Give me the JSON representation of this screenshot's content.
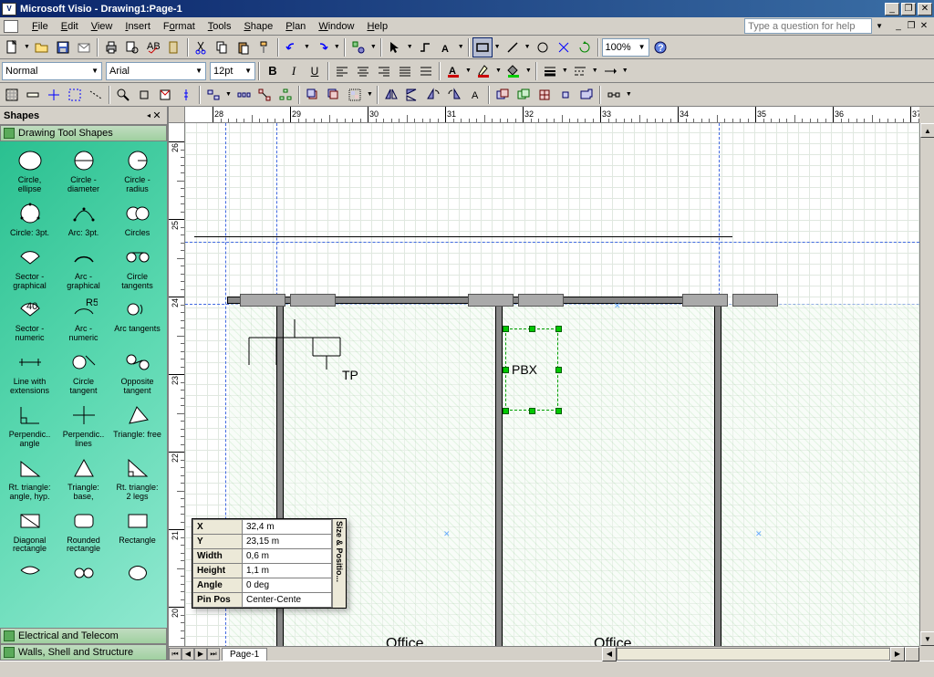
{
  "titlebar": {
    "app": "Microsoft Visio",
    "doc": "Drawing1:Page-1"
  },
  "menu": {
    "file": "File",
    "edit": "Edit",
    "view": "View",
    "insert": "Insert",
    "format": "Format",
    "tools": "Tools",
    "shape": "Shape",
    "plan": "Plan",
    "window": "Window",
    "help": "Help",
    "help_placeholder": "Type a question for help"
  },
  "toolbar2": {
    "style": "Normal",
    "font": "Arial",
    "size": "12pt",
    "zoom": "100%"
  },
  "shapes": {
    "title": "Shapes",
    "stencils": [
      "Drawing Tool Shapes",
      "Electrical and Telecom",
      "Walls, Shell and Structure"
    ],
    "items": [
      "Circle, ellipse",
      "Circle - diameter",
      "Circle - radius",
      "Circle: 3pt.",
      "Arc: 3pt.",
      "Circles",
      "Sector - graphical",
      "Arc - graphical",
      "Circle tangents",
      "Sector - numeric",
      "Arc - numeric",
      "Arc tangents",
      "Line with extensions",
      "Circle tangent",
      "Opposite tangent",
      "Perpendic.. angle",
      "Perpendic.. lines",
      "Triangle: free",
      "Rt. triangle: angle, hyp.",
      "Triangle: base,",
      "Rt. triangle: 2 legs",
      "Diagonal rectangle",
      "Rounded rectangle",
      "Rectangle"
    ]
  },
  "ruler_h_labels": [
    "28",
    "29",
    "30",
    "31",
    "32",
    "33",
    "34",
    "35",
    "36",
    "37"
  ],
  "ruler_v_labels": [
    "26",
    "25",
    "24",
    "23",
    "22",
    "21",
    "20"
  ],
  "canvas": {
    "tp_label": "TP",
    "pbx_label": "PBX",
    "office1": "Office",
    "office2": "Office"
  },
  "sizepos": {
    "title": "Size & Positio...",
    "rows": {
      "x": {
        "label": "X",
        "value": "32,4 m"
      },
      "y": {
        "label": "Y",
        "value": "23,15 m"
      },
      "width": {
        "label": "Width",
        "value": "0,6 m"
      },
      "height": {
        "label": "Height",
        "value": "1,1 m"
      },
      "angle": {
        "label": "Angle",
        "value": "0 deg"
      },
      "pinpos": {
        "label": "Pin Pos",
        "value": "Center-Cente"
      }
    }
  },
  "page_tab": "Page-1"
}
